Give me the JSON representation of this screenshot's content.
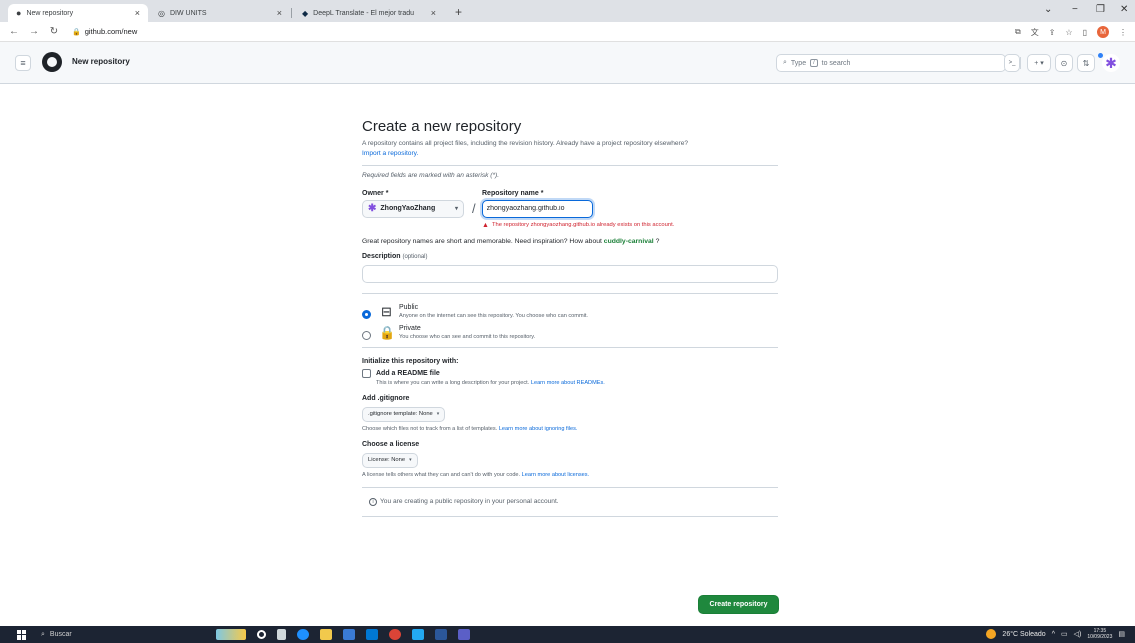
{
  "browser": {
    "tabs": [
      {
        "title": "New repository",
        "close": "×"
      },
      {
        "title": "DIW UNITS",
        "close": "×"
      },
      {
        "title": "DeepL Translate - El mejor tradu",
        "close": "×"
      }
    ],
    "new_tab": "+",
    "url": "github.com/new",
    "profile_initial": "M"
  },
  "header": {
    "page_title": "New repository",
    "search_placeholder_pre": "Type",
    "search_key": "/",
    "search_placeholder_post": "to search",
    "command_glyph": ">_",
    "create_glyph": "+ ▾"
  },
  "form": {
    "title": "Create a new repository",
    "intro": "A repository contains all project files, including the revision history. Already have a project repository elsewhere?",
    "import_link": "Import a repository.",
    "required_note": "Required fields are marked with an asterisk (*).",
    "owner_label": "Owner *",
    "repo_label": "Repository name *",
    "owner_value": "ZhongYaoZhang",
    "repo_value": "zhongyaozhang.github.io",
    "error": "The repository zhongyaozhang.github.io already exists on this account.",
    "great_prefix": "Great repository names are short and memorable. Need inspiration? How about",
    "suggestion": "cuddly-carnival",
    "great_suffix": "?",
    "description_label": "Description",
    "description_optional": "(optional)",
    "public_title": "Public",
    "public_desc": "Anyone on the internet can see this repository. You choose who can commit.",
    "private_title": "Private",
    "private_desc": "You choose who can see and commit to this repository.",
    "init_label": "Initialize this repository with:",
    "readme_title": "Add a README file",
    "readme_desc": "This is where you can write a long description for your project.",
    "readme_link": "Learn more about READMEs.",
    "gitignore_label": "Add .gitignore",
    "gitignore_select": ".gitignore template: None",
    "gitignore_desc": "Choose which files not to track from a list of templates.",
    "gitignore_link": "Learn more about ignoring files.",
    "license_label": "Choose a license",
    "license_select": "License: None",
    "license_desc": "A license tells others what they can and can't do with your code.",
    "license_link": "Learn more about licenses.",
    "info": "You are creating a public repository in your personal account.",
    "create_button": "Create repository"
  },
  "taskbar": {
    "search": "Buscar",
    "weather": "26°C Soleado",
    "time": "17:35",
    "date": "10/09/2023"
  },
  "colors": {
    "accent": "#0969da",
    "primary_button": "#1f883d",
    "error": "#cf222e",
    "suggestion": "#1a7f37"
  }
}
